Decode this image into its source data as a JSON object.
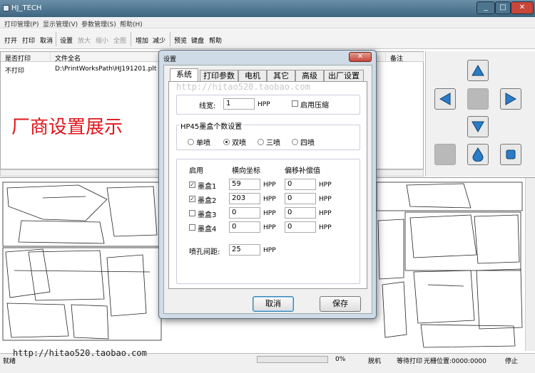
{
  "window": {
    "title": "HJ_TECH",
    "controls": [
      "_",
      "□",
      "✕"
    ]
  },
  "menu": [
    "打印管理(P)",
    "显示管理(V)",
    "参数管理(S)",
    "帮助(H)"
  ],
  "toolbar": {
    "open": "打开",
    "print": "打印",
    "cancel": "取消",
    "settings": "设置",
    "zoom_in": "放大",
    "zoom_out": "缩小",
    "fit_all": "全图",
    "add": "增加",
    "reduce": "减少",
    "preview": "预览",
    "keyboard": "键盘",
    "help": "帮助"
  },
  "filelist": {
    "columns": [
      "是否打印",
      "文件全名",
      "备注"
    ],
    "rows": [
      {
        "print": "不打印",
        "file": "D:\\PrintWorksPath\\HJ191201.plt",
        "note": ""
      }
    ]
  },
  "promo_text": "厂商设置展示",
  "watermark": "http://hitao520.taobao.com",
  "statusbar": {
    "ready": "就绪",
    "progress": "0%",
    "offline": "脱机",
    "waiting": "等待打印",
    "cursor": "光栅位置:0000:0000",
    "stop": "停止"
  },
  "control_panel": {
    "icons": [
      "arrow-up-icon",
      "arrow-left-icon",
      "arrow-right-icon",
      "arrow-down-icon",
      "ink-drop-icon",
      "stop-square-icon"
    ],
    "accent": "#2a7cc7"
  },
  "dialog": {
    "title": "设置",
    "close": "✕",
    "tabs": [
      "系统",
      "打印参数",
      "电机",
      "其它",
      "高级",
      "出厂设置"
    ],
    "active_tab": "系统",
    "watermark": "http://hitao520.taobao.com",
    "line_width": {
      "label": "线宽:",
      "value": "1",
      "unit": "HPP"
    },
    "compress": {
      "label": "启用压缩",
      "checked": false
    },
    "nozzle_group": {
      "title": "HP45墨盒个数设置",
      "options": [
        "单喷",
        "双喷",
        "三喷",
        "四喷"
      ],
      "selected": "双喷"
    },
    "cartridge_table": {
      "headers": [
        "启用",
        "横向坐标",
        "偏移补偿值"
      ],
      "unit": "HPP",
      "rows": [
        {
          "name": "墨盒1",
          "enabled": true,
          "x": "59",
          "offset": "0"
        },
        {
          "name": "墨盒2",
          "enabled": true,
          "x": "203",
          "offset": "0"
        },
        {
          "name": "墨盒3",
          "enabled": false,
          "x": "0",
          "offset": "0"
        },
        {
          "name": "墨盒4",
          "enabled": false,
          "x": "0",
          "offset": "0"
        }
      ]
    },
    "nozzle_spacing": {
      "label": "喷孔间距:",
      "value": "25",
      "unit": "HPP"
    },
    "buttons": {
      "cancel": "取消",
      "save": "保存"
    }
  }
}
